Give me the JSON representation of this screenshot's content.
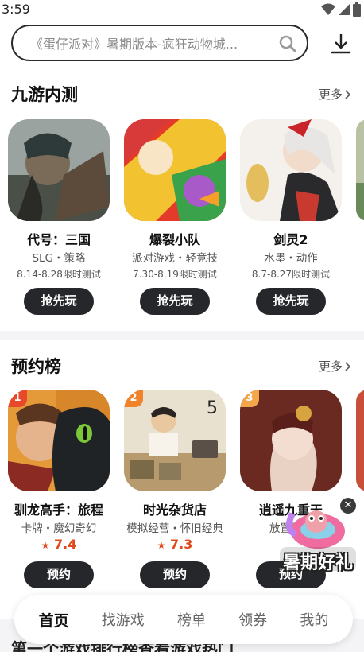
{
  "status": {
    "time": "3:59"
  },
  "search": {
    "placeholder": "《蛋仔派对》暑期版本-疯狂动物城..."
  },
  "beta": {
    "title": "九游内测",
    "more": "更多",
    "games": [
      {
        "name": "代号：三国",
        "tags": "SLG・策略",
        "date": "8.14-8.28限时测试",
        "button": "抢先玩"
      },
      {
        "name": "爆裂小队",
        "tags": "派对游戏・轻竞技",
        "date": "7.30-8.19限时测试",
        "button": "抢先玩"
      },
      {
        "name": "剑灵2",
        "tags": "水墨・动作",
        "date": "8.7-8.27限时测试",
        "button": "抢先玩"
      }
    ]
  },
  "preorder": {
    "title": "预约榜",
    "more": "更多",
    "games": [
      {
        "rank": "1",
        "name": "驯龙高手：旅程",
        "tags": "卡牌・魔幻奇幻",
        "score": "7.4",
        "button": "预约"
      },
      {
        "rank": "2",
        "name": "时光杂货店",
        "tags": "模拟经营・怀旧经典",
        "score": "7.3",
        "button": "预约"
      },
      {
        "rank": "3",
        "name": "逍遥九重天",
        "tags": "放置挂机",
        "score": "",
        "button": "预约"
      }
    ]
  },
  "promo": {
    "label": "暑期好礼"
  },
  "tabs": [
    "首页",
    "找游戏",
    "榜单",
    "领券",
    "我的"
  ],
  "below_tab_text": "第一个游戏排行榜查看游戏热门"
}
